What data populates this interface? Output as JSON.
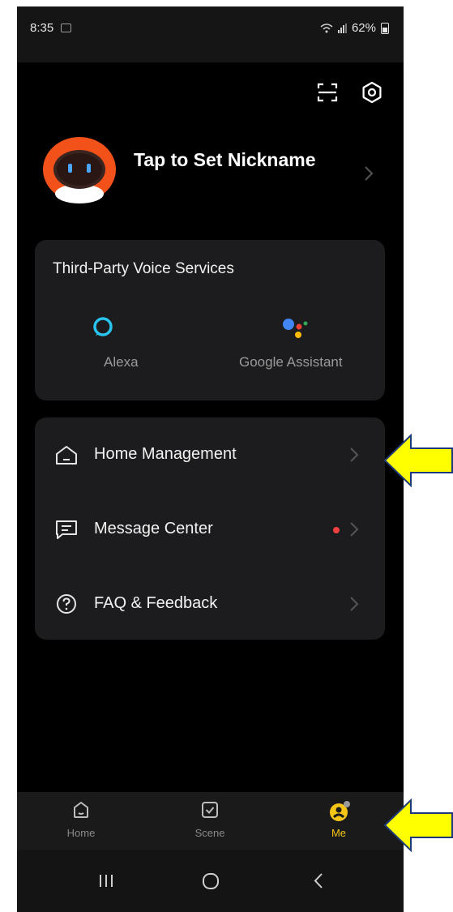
{
  "status_bar": {
    "time": "8:35",
    "battery": "62%"
  },
  "header": {
    "scan_icon": "scan-icon",
    "settings_icon": "settings-hexagon-icon"
  },
  "profile": {
    "nickname": "Tap to Set Nickname",
    "avatar_icon": "robot-avatar-icon"
  },
  "voice_services": {
    "title": "Third-Party Voice Services",
    "items": [
      {
        "label": "Alexa",
        "icon": "alexa-icon"
      },
      {
        "label": "Google Assistant",
        "icon": "google-assistant-icon"
      }
    ]
  },
  "menu": {
    "items": [
      {
        "label": "Home Management",
        "icon": "home-outline-icon",
        "badge": false
      },
      {
        "label": "Message Center",
        "icon": "message-icon",
        "badge": true
      },
      {
        "label": "FAQ & Feedback",
        "icon": "question-icon",
        "badge": false
      }
    ]
  },
  "tab_bar": {
    "tabs": [
      {
        "label": "Home",
        "icon": "home-icon",
        "active": false
      },
      {
        "label": "Scene",
        "icon": "scene-checkbox-icon",
        "active": false
      },
      {
        "label": "Me",
        "icon": "me-profile-icon",
        "active": true
      }
    ]
  },
  "nav_bar": {
    "buttons": [
      "recents-icon",
      "home-circle-icon",
      "back-icon"
    ]
  },
  "colors": {
    "accent": "#f5c518",
    "background": "#000000",
    "card": "#1c1c1e",
    "badge": "#f04040",
    "annotation_arrow": "#ffff00"
  }
}
